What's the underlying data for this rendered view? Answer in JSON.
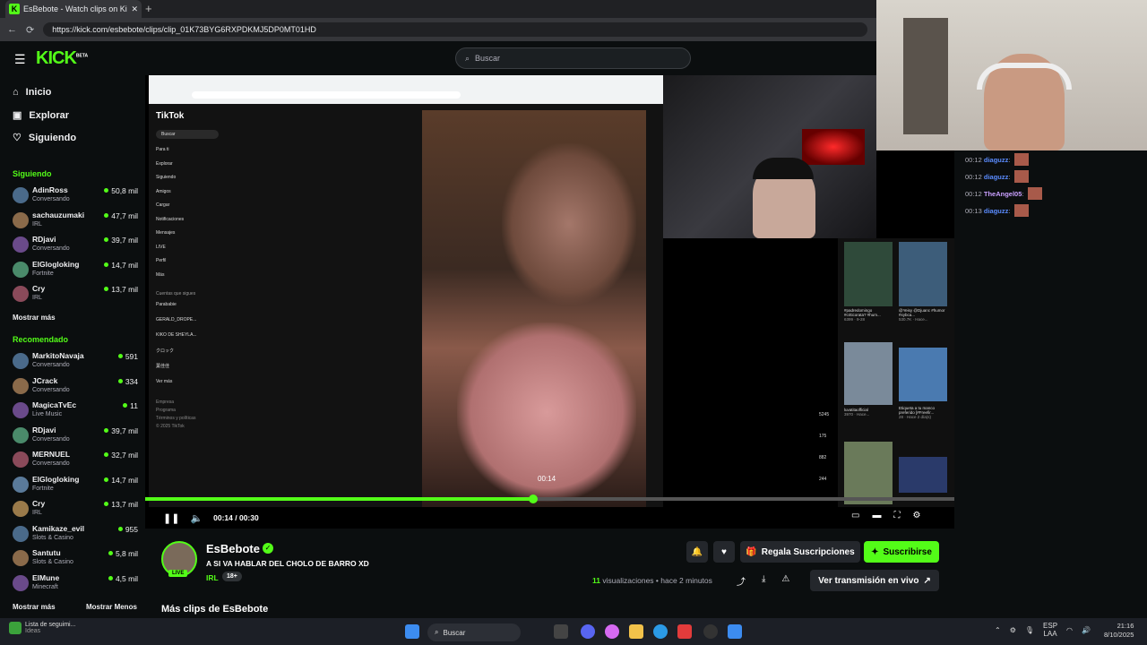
{
  "browser": {
    "tab_title": "EsBebote - Watch clips on Ki",
    "tab_favicon": "K",
    "url": "https://kick.com/esbebote/clips/clip_01K73BYG6RXPDKMJ5DP0MT01HD"
  },
  "header": {
    "logo": "KICK",
    "logo_badge": "BETA",
    "search_placeholder": "Buscar"
  },
  "sidebar": {
    "nav": [
      {
        "label": "Inicio",
        "icon": "home-icon"
      },
      {
        "label": "Explorar",
        "icon": "compass-icon"
      },
      {
        "label": "Siguiendo",
        "icon": "heart-icon"
      }
    ],
    "following_title": "Siguiendo",
    "following": [
      {
        "name": "AdinRoss",
        "category": "Conversando",
        "viewers": "50,8 mil"
      },
      {
        "name": "sachauzumaki",
        "category": "IRL",
        "viewers": "47,7 mil"
      },
      {
        "name": "RDjavi",
        "category": "Conversando",
        "viewers": "39,7 mil"
      },
      {
        "name": "ElGlogloking",
        "category": "Fortnite",
        "viewers": "14,7 mil"
      },
      {
        "name": "Cry",
        "category": "IRL",
        "viewers": "13,7 mil"
      }
    ],
    "show_more": "Mostrar más",
    "recommended_title": "Recomendado",
    "recommended": [
      {
        "name": "MarkitoNavaja",
        "category": "Conversando",
        "viewers": "591"
      },
      {
        "name": "JCrack",
        "category": "Conversando",
        "viewers": "334"
      },
      {
        "name": "MagicaTvEc",
        "category": "Live Music",
        "viewers": "11"
      },
      {
        "name": "RDjavi",
        "category": "Conversando",
        "viewers": "39,7 mil"
      },
      {
        "name": "MERNUEL",
        "category": "Conversando",
        "viewers": "32,7 mil"
      },
      {
        "name": "ElGlogloking",
        "category": "Fortnite",
        "viewers": "14,7 mil"
      },
      {
        "name": "Cry",
        "category": "IRL",
        "viewers": "13,7 mil"
      },
      {
        "name": "Kamikaze_evil",
        "category": "Slots & Casino",
        "viewers": "955"
      },
      {
        "name": "Santutu",
        "category": "Slots & Casino",
        "viewers": "5,8 mil"
      },
      {
        "name": "ElMune",
        "category": "Minecraft",
        "viewers": "4,5 mil"
      }
    ],
    "show_more_bottom": "Mostrar más",
    "show_less": "Mostrar Menos"
  },
  "tiktok": {
    "logo": "TikTok",
    "search": "Buscar",
    "menu": [
      "Para ti",
      "Explorar",
      "Siguiendo",
      "Amigos",
      "Cargar",
      "Notificaciones",
      "Mensajes",
      "LIVE",
      "Perfil",
      "Más"
    ],
    "following_title": "Cuentas que sigues",
    "accounts": [
      "Parababie",
      "GERALD_DROPE...",
      "KIKO DE SHEYLA...",
      "クロック",
      "葉佳佳"
    ],
    "see_more": "Ver más",
    "footer": [
      "Empresa",
      "Programa",
      "Términos y políticas",
      "© 2025 TikTok"
    ],
    "side_counts": [
      "5245",
      "175",
      "882",
      "244"
    ],
    "feed": [
      {
        "caption": "#padredomingo #criticorata? #hum...",
        "meta": "6399 · 9-28"
      },
      {
        "caption": "@Yeisy @Djuanc #humor #xybca...",
        "meta": "530.7K · Hace..."
      },
      {
        "caption": "luvatitaofficial",
        "meta": "3970 · Hace..."
      },
      {
        "caption": "Etiqueta a tu manco preferido [#Freefir...",
        "meta": "28 · Hace 2 día(s)"
      }
    ]
  },
  "chat": [
    {
      "time": "00:12",
      "user": "diaguzz",
      "color": "blue"
    },
    {
      "time": "00:12",
      "user": "diaguzz",
      "color": "blue"
    },
    {
      "time": "00:12",
      "user": "TheAngel05",
      "color": "purple"
    },
    {
      "time": "00:13",
      "user": "diaguzz",
      "color": "blue"
    }
  ],
  "player": {
    "time_current": "00:14",
    "time_total": "00:30",
    "time_label": "00:14 / 00:30",
    "progress": 0.48,
    "tooltip": "00:14"
  },
  "clip": {
    "channel": "EsBebote",
    "live_badge": "LIVE",
    "title": "A SI VA HABLAR DEL CHOLO DE BARRO XD",
    "category": "IRL",
    "age": "18+",
    "views_count": "11",
    "views_label": "visualizaciones",
    "time_ago": "hace 2 minutos",
    "gift_label": "Regala Suscripciones",
    "subscribe_label": "Suscribirse",
    "watch_live_label": "Ver transmisión en vivo",
    "more_clips": "Más clips de EsBebote"
  },
  "taskbar": {
    "widget_title": "Lista de seguimi...",
    "widget_sub": "Ideas",
    "search": "Buscar",
    "lang": "ESP",
    "lang_sub": "LAA",
    "time": "21:16",
    "date": "8/10/2025"
  },
  "colors": {
    "accent": "#53fc18",
    "bg": "#0b0e0f",
    "button": "#24272c"
  }
}
